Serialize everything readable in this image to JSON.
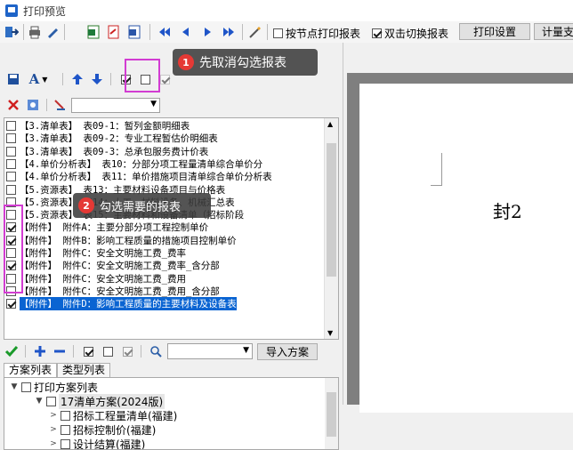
{
  "window": {
    "title": "打印预览"
  },
  "toolbar": {
    "print_by_node_label": "按节点打印报表",
    "print_by_node_checked": false,
    "dblclick_switch_label": "双击切换报表",
    "dblclick_switch_checked": true,
    "print_settings_label": "打印设置",
    "meter_label": "计量支"
  },
  "tips": {
    "tip1_num": "1",
    "tip1_text": "先取消勾选报表",
    "tip2_num": "2",
    "tip2_text": "勾选需要的报表"
  },
  "report_list": [
    {
      "checked": false,
      "text": "【3.清单表】 表09-1：暂列金额明细表",
      "selected": false
    },
    {
      "checked": false,
      "text": "【3.清单表】 表09-2：专业工程暂估价明细表",
      "selected": false
    },
    {
      "checked": false,
      "text": "【3.清单表】 表09-3：总承包服务费计价表",
      "selected": false
    },
    {
      "checked": false,
      "text": "【4.单价分析表】 表10：分部分项工程量清单综合单价分",
      "selected": false
    },
    {
      "checked": false,
      "text": "【4.单价分析表】 表11：单价措施项目清单综合单价分析表",
      "selected": false
    },
    {
      "checked": false,
      "text": "【5.资源表】 表13：主要材料设备项目与价格表",
      "selected": false
    },
    {
      "checked": false,
      "text": "【5.资源表】 表14：人工、材料设备、机械汇总表",
      "selected": false
    },
    {
      "checked": false,
      "text": "【5.资源表】 表15：主要材料和设备清单（招标阶段",
      "selected": false
    },
    {
      "checked": true,
      "text": "【附件】 附件A：主要分部分项工程控制单价",
      "selected": false
    },
    {
      "checked": true,
      "text": "【附件】 附件B：影响工程质量的措施项目控制单价",
      "selected": false
    },
    {
      "checked": false,
      "text": "【附件】 附件C：安全文明施工费_费率",
      "selected": false
    },
    {
      "checked": true,
      "text": "【附件】 附件C：安全文明施工费_费率_含分部",
      "selected": false
    },
    {
      "checked": false,
      "text": "【附件】 附件C：安全文明施工费_费用",
      "selected": false
    },
    {
      "checked": false,
      "text": "【附件】 附件C：安全文明施工费_费用_含分部",
      "selected": false
    },
    {
      "checked": true,
      "text": "【附件】 附件D：影响工程质量的主要材料及设备表",
      "selected": true
    }
  ],
  "bottom": {
    "import_label": "导入方案",
    "tab_scheme": "方案列表",
    "tab_type": "类型列表"
  },
  "tree": {
    "root": "打印方案列表",
    "scheme": "17清单方案(2024版)",
    "item1": "招标工程量清单(福建)",
    "item2": "招标控制价(福建)",
    "item3": "设计结算(福建)"
  },
  "preview": {
    "page_label": "封2"
  },
  "colors": {
    "highlight": "#d23cd2",
    "selection": "#0a64d2",
    "badge": "#e53935"
  }
}
